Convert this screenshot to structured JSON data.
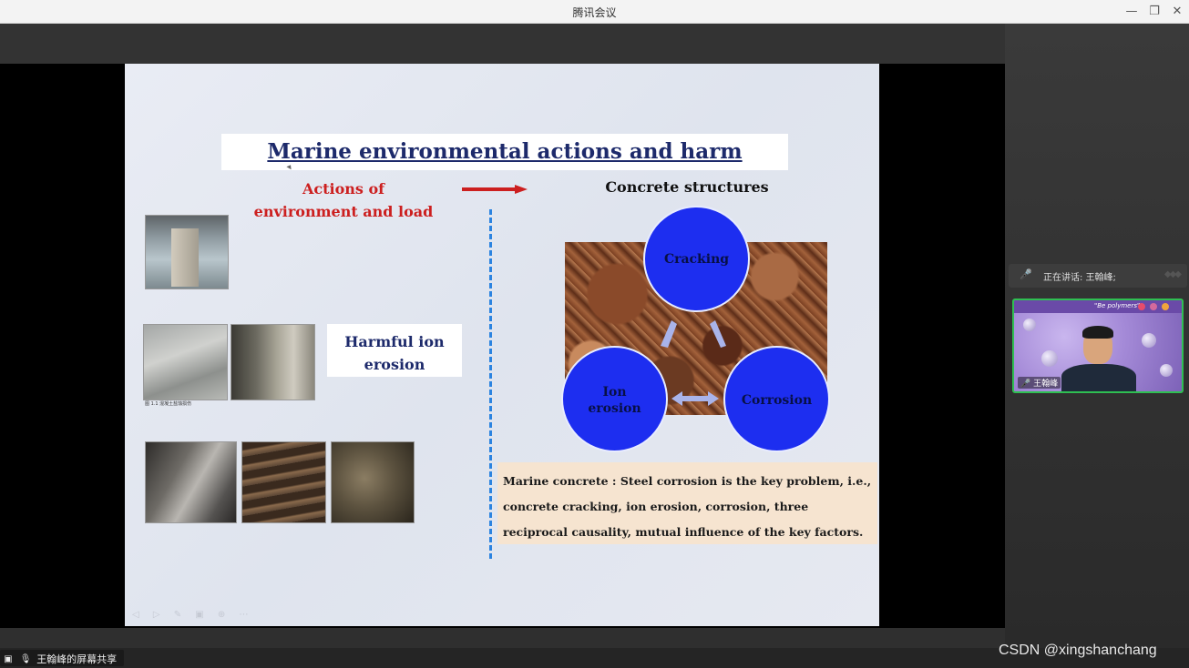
{
  "window": {
    "title": "腾讯会议"
  },
  "slide": {
    "title": "Marine environmental actions and harm",
    "actions_label_line1": "Actions of",
    "actions_label_line2": "environment and load",
    "concrete_label": "Concrete structures",
    "harm_line1": "Harmful ion",
    "harm_line2": "erosion",
    "circles": {
      "cracking": "Cracking",
      "ion_line1": "Ion",
      "ion_line2": "erosion",
      "corrosion": "Corrosion"
    },
    "note": "Marine concrete : Steel corrosion is the key problem, i.e., concrete cracking, ion erosion, corrosion, three reciprocal causality, mutual influence of the key factors.",
    "photo_caption": "图 1.1 混凝土盐蚀损伤"
  },
  "side_panel": {
    "speaking_text": "正在讲话: 王翰峰;",
    "video_name": "王翰峰",
    "video_banner": "\"Be polymers\""
  },
  "status_bar": {
    "share_label": "王翰峰的屏幕共享"
  },
  "watermark": "CSDN @xingshanchang",
  "colors": {
    "title_blue": "#1d2a6b",
    "accent_red": "#cc1f1f",
    "circle_blue": "#1d2ef0",
    "dash_blue": "#2b83e0",
    "note_bg": "#f6e4d0",
    "active_speaker_green": "#2fbf52"
  }
}
